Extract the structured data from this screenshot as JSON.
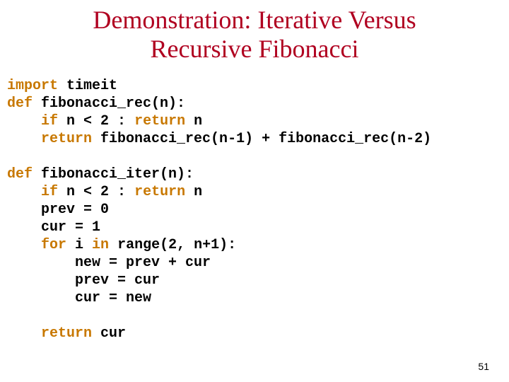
{
  "title_line1": "Demonstration: Iterative Versus",
  "title_line2": "Recursive Fibonacci",
  "page_number": "51",
  "code": {
    "kw_import": "import",
    "l1_rest": " timeit",
    "kw_def1": "def",
    "l2_rest": " fibonacci_rec(n):",
    "kw_if1": "if",
    "l3_mid": " n < 2 : ",
    "kw_return1": "return",
    "l3_rest": " n",
    "kw_return2": "return",
    "l4_rest": " fibonacci_rec(n-1) + fibonacci_rec(n-2)",
    "kw_def2": "def",
    "l6_rest": " fibonacci_iter(n):",
    "kw_if2": "if",
    "l7_mid": " n < 2 : ",
    "kw_return3": "return",
    "l7_rest": " n",
    "l8": "    prev = 0",
    "l9": "    cur = 1",
    "kw_for": "for",
    "l10_mid": " i ",
    "kw_in": "in",
    "l10_rest": " range(2, n+1):",
    "l11": "        new = prev + cur",
    "l12": "        prev = cur",
    "l13": "        cur = new",
    "kw_return4": "return",
    "l15_rest": " cur"
  }
}
